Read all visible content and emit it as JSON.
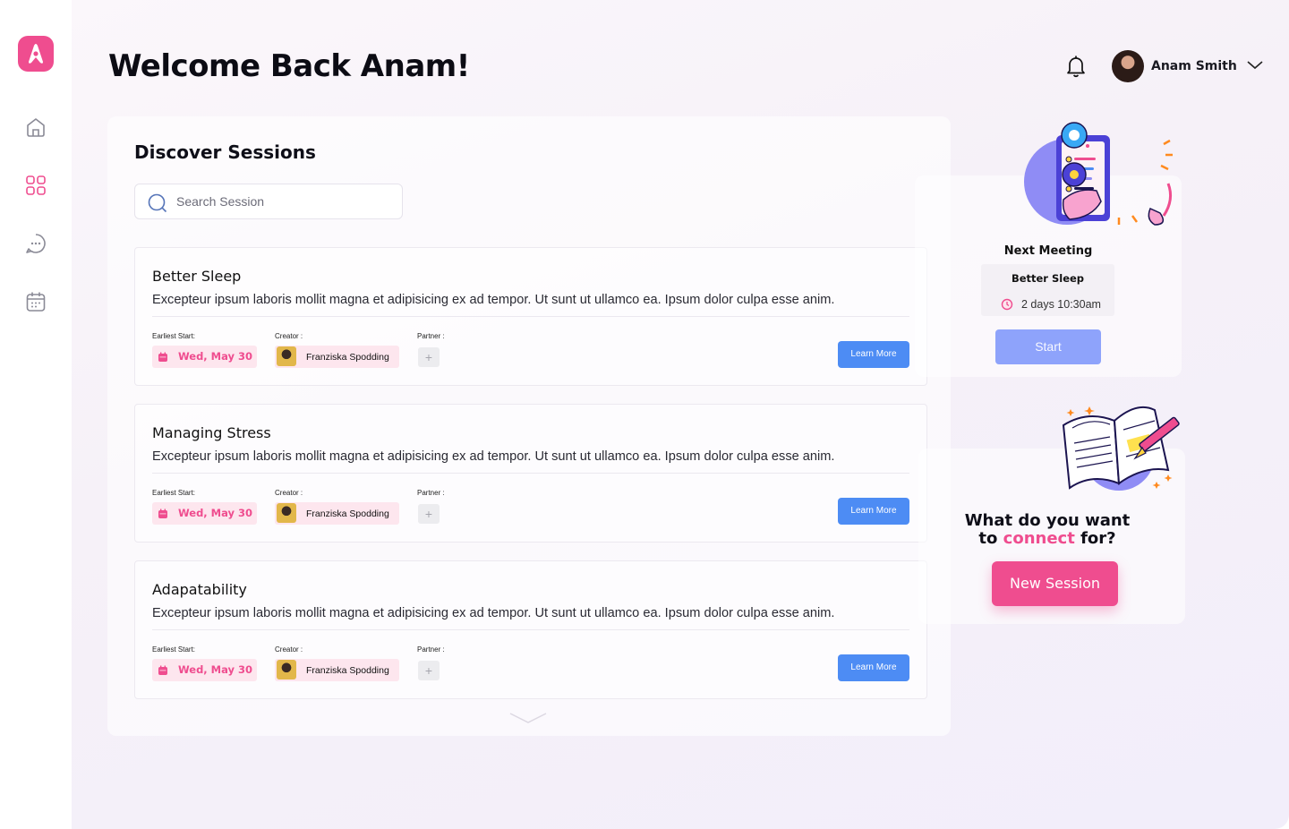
{
  "app": {
    "logo_icon": "app-logo-a",
    "accent_color": "#ef4d8f",
    "button_blue": "#4d8cf4"
  },
  "sidebar": {
    "items": [
      {
        "icon": "home-icon",
        "active": false
      },
      {
        "icon": "grid-icon",
        "active": true
      },
      {
        "icon": "chat-icon",
        "active": false
      },
      {
        "icon": "calendar-icon",
        "active": false
      }
    ]
  },
  "header": {
    "welcome": "Welcome Back Anam!",
    "user_name": "Anam Smith"
  },
  "discover": {
    "title": "Discover Sessions",
    "search_placeholder": "Search Session",
    "labels": {
      "earliest_start": "Earliest Start:",
      "creator": "Creator :",
      "partner": "Partner :"
    },
    "sessions": [
      {
        "title": "Better Sleep",
        "description": "Excepteur ipsum laboris mollit magna et adipisicing ex ad tempor. Ut sunt ut ullamco ea. Ipsum dolor culpa esse anim.",
        "date": "Wed, May 30",
        "creator": "Franziska Spodding",
        "partner_add": "+",
        "cta": "Learn More"
      },
      {
        "title": "Managing Stress",
        "description": "Excepteur ipsum laboris mollit magna et adipisicing ex ad tempor. Ut sunt ut ullamco ea. Ipsum dolor culpa esse anim.",
        "date": "Wed, May 30",
        "creator": "Franziska Spodding",
        "partner_add": "+",
        "cta": "Learn More"
      },
      {
        "title": "Adapatability",
        "description": "Excepteur ipsum laboris mollit magna et adipisicing ex ad tempor. Ut sunt ut ullamco ea. Ipsum dolor culpa esse anim.",
        "date": "Wed, May 30",
        "creator": "Franziska Spodding",
        "partner_add": "+",
        "cta": "Learn More"
      }
    ]
  },
  "next_meeting": {
    "label": "Next Meeting",
    "title": "Better Sleep",
    "time": "2 days 10:30am",
    "start": "Start"
  },
  "connect": {
    "question_line1": "What do you want",
    "question_to": "to",
    "question_accent": "connect",
    "question_end": "for?",
    "new_session": "New Session"
  }
}
